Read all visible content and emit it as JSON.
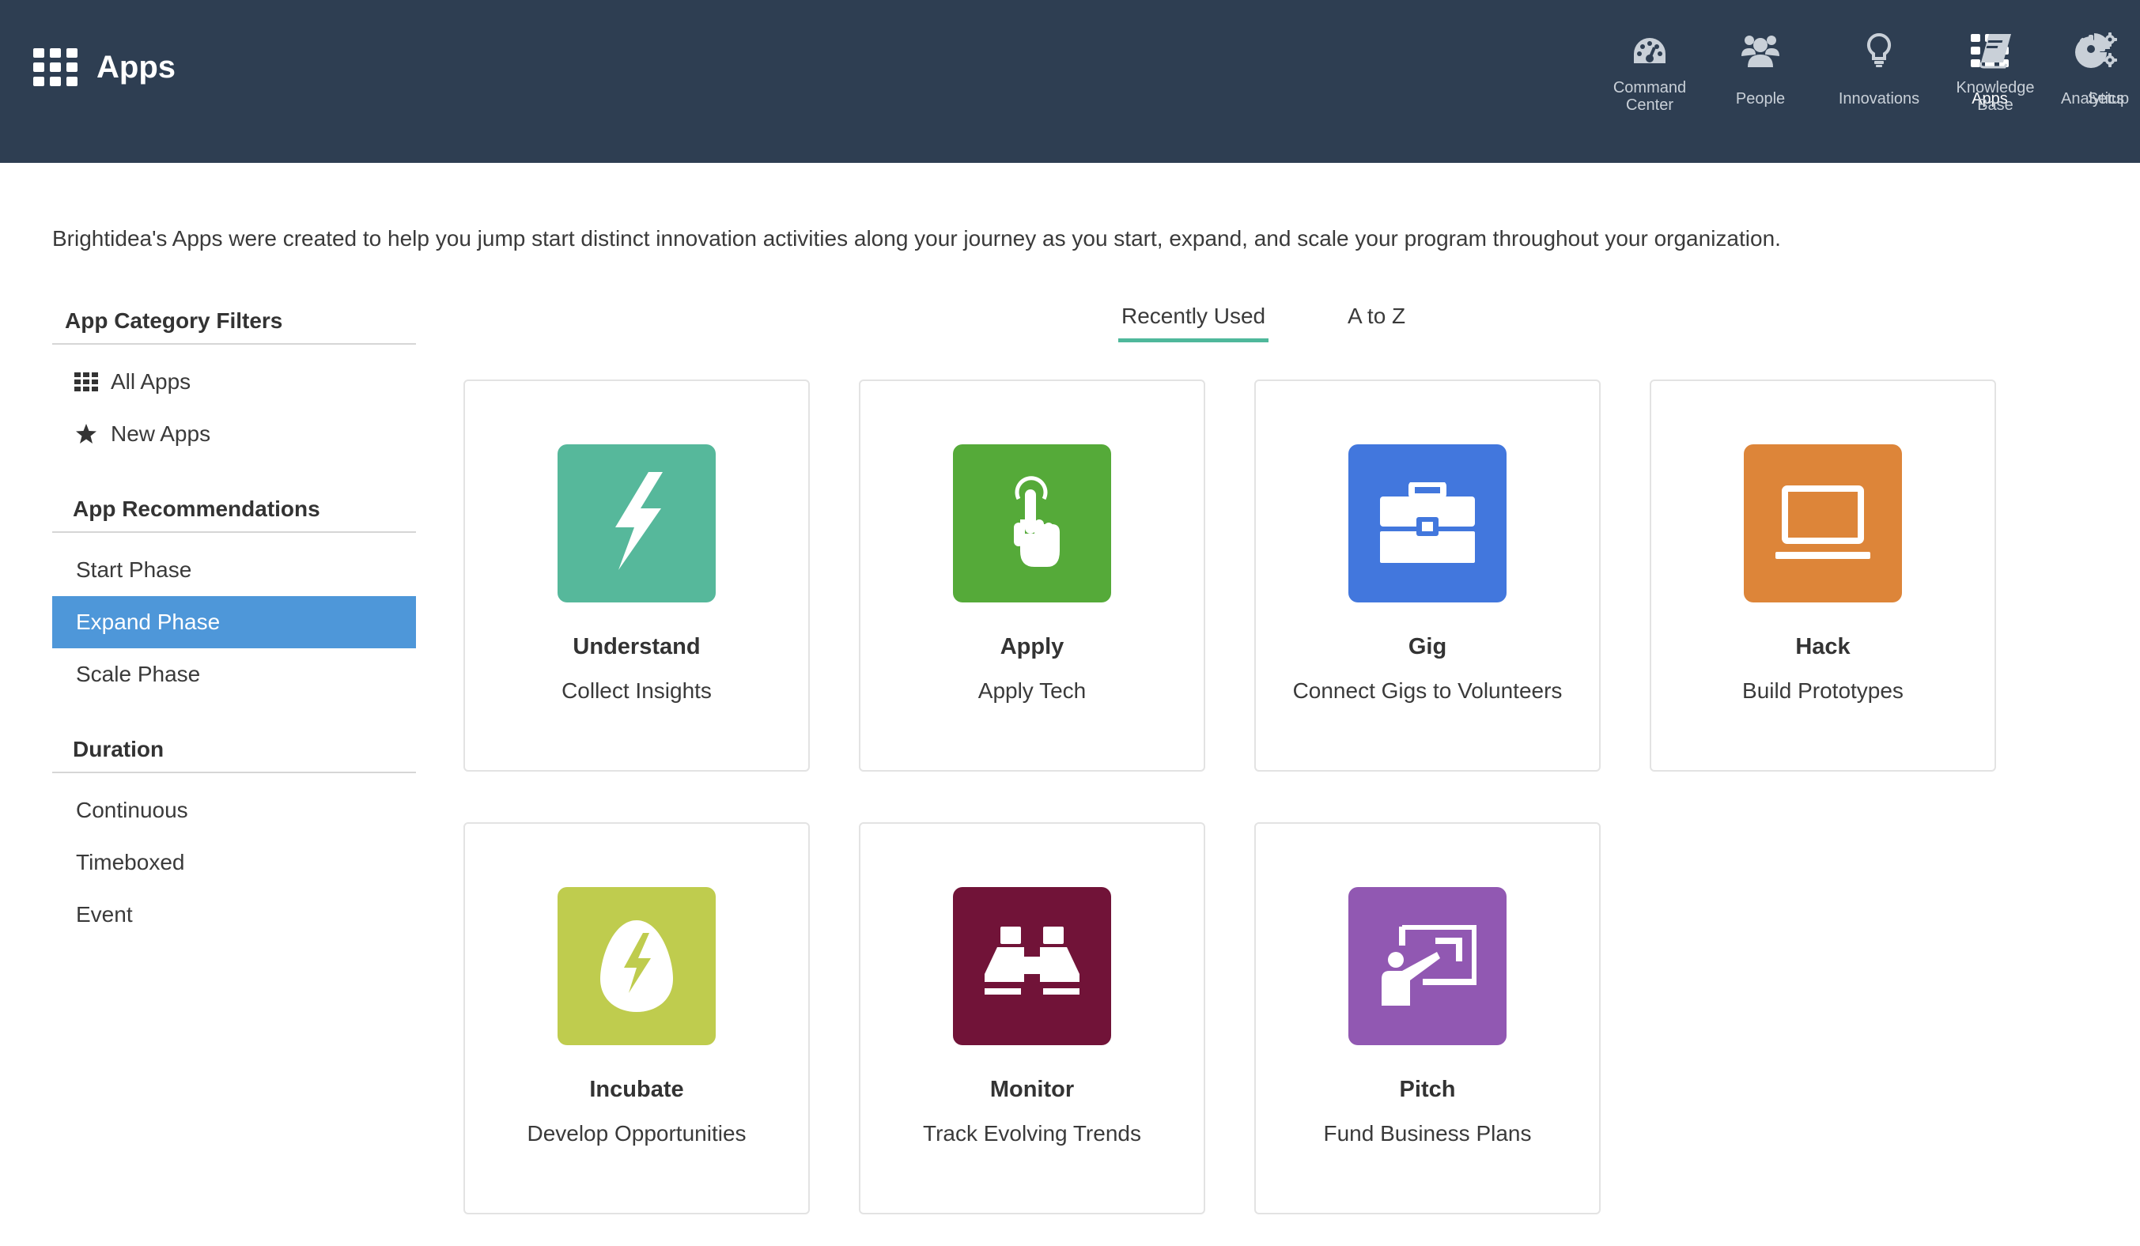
{
  "header": {
    "app_title": "Apps",
    "nav": [
      {
        "label": "Command\nCenter",
        "icon": "dashboard-icon"
      },
      {
        "label": "People",
        "icon": "people-icon"
      },
      {
        "label": "Innovations",
        "icon": "lightbulb-icon"
      },
      {
        "label": "Apps",
        "icon": "apps-grid-icon"
      },
      {
        "label": "Analytics",
        "icon": "pie-chart-icon"
      },
      {
        "label": "Knowledge\nBase",
        "icon": "book-icon"
      },
      {
        "label": "Setup",
        "icon": "gears-icon"
      }
    ],
    "active_nav": "Apps"
  },
  "intro": "Brightidea's Apps were created to help you jump start distinct innovation activities along your journey as you start, expand, and scale your program throughout your organization.",
  "sidebar": {
    "category_heading": "App Category Filters",
    "category_items": [
      {
        "label": "All Apps",
        "icon": "grid-icon"
      },
      {
        "label": "New Apps",
        "icon": "star-icon"
      }
    ],
    "recommendations_heading": "App Recommendations",
    "recommendation_items": [
      {
        "label": "Start Phase"
      },
      {
        "label": "Expand Phase",
        "selected": true
      },
      {
        "label": "Scale Phase"
      }
    ],
    "duration_heading": "Duration",
    "duration_items": [
      {
        "label": "Continuous"
      },
      {
        "label": "Timeboxed"
      },
      {
        "label": "Event"
      }
    ]
  },
  "tabs": [
    {
      "label": "Recently Used",
      "active": true
    },
    {
      "label": "A to Z",
      "active": false
    }
  ],
  "apps": [
    {
      "name": "Understand",
      "description": "Collect Insights",
      "color": "#56b89b",
      "icon": "lightning-bolt-icon"
    },
    {
      "name": "Apply",
      "description": "Apply Tech",
      "color": "#55aa39",
      "icon": "tap-finger-icon"
    },
    {
      "name": "Gig",
      "description": "Connect Gigs to Volunteers",
      "color": "#4277dd",
      "icon": "briefcase-icon"
    },
    {
      "name": "Hack",
      "description": "Build Prototypes",
      "color": "#dd8539",
      "icon": "laptop-icon"
    },
    {
      "name": "Incubate",
      "description": "Develop Opportunities",
      "color": "#bfcc4e",
      "icon": "egg-bolt-icon"
    },
    {
      "name": "Monitor",
      "description": "Track Evolving Trends",
      "color": "#711338",
      "icon": "binoculars-icon"
    },
    {
      "name": "Pitch",
      "description": "Fund Business Plans",
      "color": "#9158b2",
      "icon": "presenter-icon"
    }
  ],
  "colors": {
    "header_bg": "#2e3e52",
    "selected_bg": "#4e97d9",
    "tab_underline": "#4fb89b"
  }
}
